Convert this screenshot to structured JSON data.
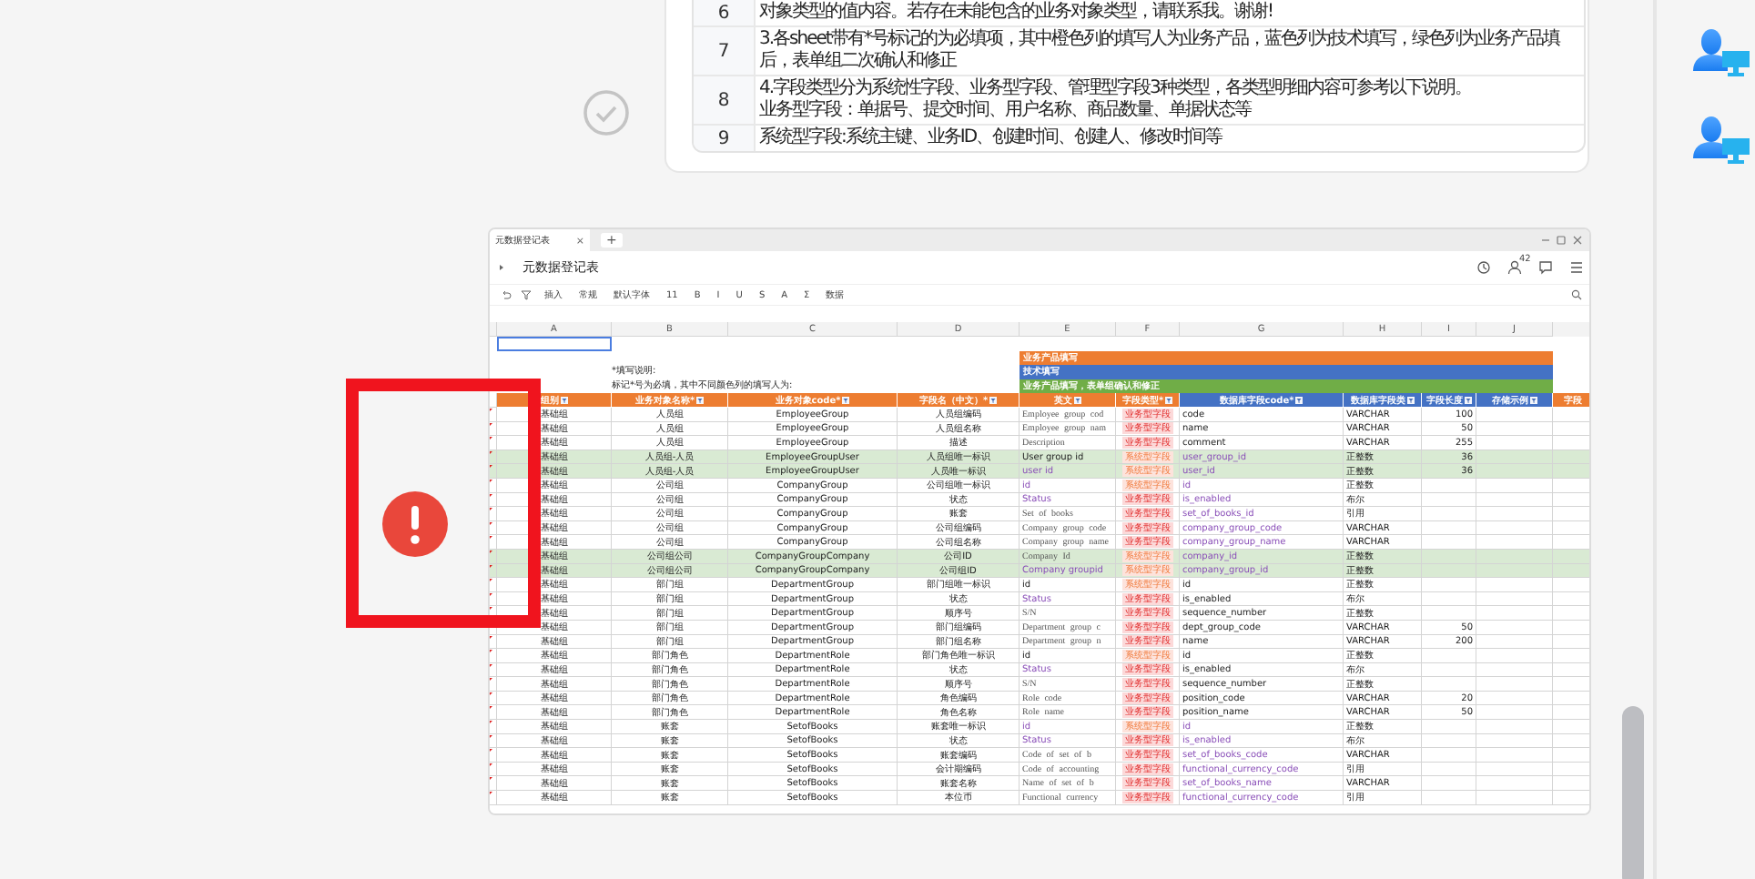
{
  "notes_card": {
    "rows": [
      {
        "number": "6",
        "lines": [
          "对象类型的值内容。若存在未能包含的业务对象类型，请联系我。谢谢!"
        ]
      },
      {
        "number": "7",
        "lines": [
          "3.各sheet带有*号标记的为必填项，其中橙色列的填写人为业务产品，蓝色列为技术填写，绿色列为业务产品填",
          "后，表单组二次确认和修正"
        ]
      },
      {
        "number": "8",
        "lines": [
          "4.字段类型分为系统性字段、业务型字段、管理型字段3种类型，各类型明细内容可参考以下说明。",
          "业务型字段：单据号、提交时间、用户名称、商品数量、单据状态等"
        ]
      },
      {
        "number": "9",
        "lines": [
          "系统型字段:系统主键、业务ID、创建时间、创建人、修改时间等"
        ]
      }
    ]
  },
  "sheet": {
    "tab": "元数据登记表",
    "tab_close": "×",
    "new_tab": "+",
    "title": "元数据登记表",
    "notification_count": "42",
    "toolbar": [
      "插入",
      "常规",
      "默认字体",
      "11",
      "B",
      "I",
      "U",
      "S",
      "A",
      "Σ",
      "数据"
    ],
    "column_letters": [
      "A",
      "B",
      "C",
      "D",
      "E",
      "F",
      "G",
      "H",
      "I",
      "J"
    ],
    "instructions": [
      "*填写说明:",
      "标记*号为必填，其中不同颜色列的填写人为:"
    ],
    "legend": [
      {
        "label": "业务产品填写",
        "color": "#ed7d31"
      },
      {
        "label": "技术填写",
        "color": "#4472c4"
      },
      {
        "label": "业务产品填写，表单组确认和修正",
        "color": "#70ad47"
      }
    ],
    "columns": [
      {
        "label": "组别",
        "color": "#ed7d31"
      },
      {
        "label": "业务对象名称*",
        "color": "#ed7d31"
      },
      {
        "label": "业务对象code*",
        "color": "#ed7d31"
      },
      {
        "label": "字段名（中文）*",
        "color": "#ed7d31"
      },
      {
        "label": "英文",
        "color": "#ed7d31"
      },
      {
        "label": "字段类型*",
        "color": "#ed7d31"
      },
      {
        "label": "数据库字段code*",
        "color": "#4472c4"
      },
      {
        "label": "数据库字段类",
        "color": "#4472c4"
      },
      {
        "label": "字段长度",
        "color": "#4472c4"
      },
      {
        "label": "存储示例",
        "color": "#4472c4"
      },
      {
        "label": "字段",
        "color": "#ed7d31"
      }
    ],
    "rows": [
      {
        "highlighted": false,
        "system_field": false,
        "english_serif": true,
        "english_link": false,
        "code_link": false,
        "cells": [
          "基础组",
          "人员组",
          "EmployeeGroup",
          "人员组编码",
          "Employee group cod",
          "业务型字段",
          "code",
          "VARCHAR",
          "100"
        ]
      },
      {
        "highlighted": false,
        "system_field": false,
        "english_serif": true,
        "english_link": false,
        "code_link": false,
        "cells": [
          "基础组",
          "人员组",
          "EmployeeGroup",
          "人员组名称",
          "Employee group nam",
          "业务型字段",
          "name",
          "VARCHAR",
          "50"
        ]
      },
      {
        "highlighted": false,
        "system_field": false,
        "english_serif": true,
        "english_link": false,
        "code_link": false,
        "cells": [
          "基础组",
          "人员组",
          "EmployeeGroup",
          "描述",
          "Description",
          "业务型字段",
          "comment",
          "VARCHAR",
          "255"
        ]
      },
      {
        "highlighted": true,
        "system_field": true,
        "english_serif": false,
        "english_link": false,
        "code_link": true,
        "cells": [
          "基础组",
          "人员组-人员",
          "EmployeeGroupUser",
          "人员组唯一标识",
          "User group id",
          "系统型字段",
          "user_group_id",
          "正整数",
          "36"
        ]
      },
      {
        "highlighted": true,
        "system_field": true,
        "english_serif": false,
        "english_link": true,
        "code_link": true,
        "cells": [
          "基础组",
          "人员组-人员",
          "EmployeeGroupUser",
          "人员唯一标识",
          "user id",
          "系统型字段",
          "user_id",
          "正整数",
          "36"
        ]
      },
      {
        "highlighted": false,
        "system_field": true,
        "english_serif": false,
        "english_link": true,
        "code_link": true,
        "cells": [
          "基础组",
          "公司组",
          "CompanyGroup",
          "公司组唯一标识",
          "id",
          "系统型字段",
          "id",
          "正整数"
        ]
      },
      {
        "highlighted": false,
        "system_field": false,
        "english_serif": false,
        "english_link": true,
        "code_link": true,
        "cells": [
          "基础组",
          "公司组",
          "CompanyGroup",
          "状态",
          "Status",
          "业务型字段",
          "is_enabled",
          "布尔"
        ]
      },
      {
        "highlighted": false,
        "system_field": false,
        "english_serif": true,
        "english_link": false,
        "code_link": true,
        "cells": [
          "基础组",
          "公司组",
          "CompanyGroup",
          "账套",
          "Set of books",
          "业务型字段",
          "set_of_books_id",
          "引用"
        ]
      },
      {
        "highlighted": false,
        "system_field": false,
        "english_serif": true,
        "english_link": false,
        "code_link": true,
        "cells": [
          "基础组",
          "公司组",
          "CompanyGroup",
          "公司组编码",
          "Company group code",
          "业务型字段",
          "company_group_code",
          "VARCHAR"
        ]
      },
      {
        "highlighted": false,
        "system_field": false,
        "english_serif": true,
        "english_link": false,
        "code_link": true,
        "cells": [
          "基础组",
          "公司组",
          "CompanyGroup",
          "公司组名称",
          "Company group name",
          "业务型字段",
          "company_group_name",
          "VARCHAR"
        ]
      },
      {
        "highlighted": true,
        "system_field": true,
        "english_serif": true,
        "english_link": false,
        "code_link": true,
        "cells": [
          "基础组",
          "公司组公司",
          "CompanyGroupCompany",
          "公司ID",
          "Company Id",
          "系统型字段",
          "company_id",
          "正整数"
        ]
      },
      {
        "highlighted": true,
        "system_field": true,
        "english_serif": false,
        "english_link": true,
        "code_link": true,
        "cells": [
          "基础组",
          "公司组公司",
          "CompanyGroupCompany",
          "公司组ID",
          "Company groupid",
          "系统型字段",
          "company_group_id",
          "正整数"
        ]
      },
      {
        "highlighted": false,
        "system_field": true,
        "english_serif": false,
        "english_link": false,
        "code_link": false,
        "cells": [
          "基础组",
          "部门组",
          "DepartmentGroup",
          "部门组唯一标识",
          "id",
          "系统型字段",
          "id",
          "正整数"
        ]
      },
      {
        "highlighted": false,
        "system_field": false,
        "english_serif": false,
        "english_link": true,
        "code_link": false,
        "cells": [
          "基础组",
          "部门组",
          "DepartmentGroup",
          "状态",
          "Status",
          "业务型字段",
          "is_enabled",
          "布尔"
        ]
      },
      {
        "highlighted": false,
        "system_field": false,
        "english_serif": true,
        "english_link": false,
        "code_link": false,
        "cells": [
          "基础组",
          "部门组",
          "DepartmentGroup",
          "顺序号",
          "S/N",
          "业务型字段",
          "sequence_number",
          "正整数"
        ]
      },
      {
        "highlighted": false,
        "system_field": false,
        "english_serif": true,
        "english_link": false,
        "code_link": false,
        "cells": [
          "基础组",
          "部门组",
          "DepartmentGroup",
          "部门组编码",
          "Department group c",
          "业务型字段",
          "dept_group_code",
          "VARCHAR",
          "50"
        ]
      },
      {
        "highlighted": false,
        "system_field": false,
        "english_serif": true,
        "english_link": false,
        "code_link": false,
        "cells": [
          "基础组",
          "部门组",
          "DepartmentGroup",
          "部门组名称",
          "Department group n",
          "业务型字段",
          "name",
          "VARCHAR",
          "200"
        ]
      },
      {
        "highlighted": false,
        "system_field": true,
        "english_serif": false,
        "english_link": false,
        "code_link": false,
        "cells": [
          "基础组",
          "部门角色",
          "DepartmentRole",
          "部门角色唯一标识",
          "id",
          "系统型字段",
          "id",
          "正整数"
        ]
      },
      {
        "highlighted": false,
        "system_field": false,
        "english_serif": false,
        "english_link": true,
        "code_link": false,
        "cells": [
          "基础组",
          "部门角色",
          "DepartmentRole",
          "状态",
          "Status",
          "业务型字段",
          "is_enabled",
          "布尔"
        ]
      },
      {
        "highlighted": false,
        "system_field": false,
        "english_serif": true,
        "english_link": false,
        "code_link": false,
        "cells": [
          "基础组",
          "部门角色",
          "DepartmentRole",
          "顺序号",
          "S/N",
          "业务型字段",
          "sequence_number",
          "正整数"
        ]
      },
      {
        "highlighted": false,
        "system_field": false,
        "english_serif": true,
        "english_link": false,
        "code_link": false,
        "cells": [
          "基础组",
          "部门角色",
          "DepartmentRole",
          "角色编码",
          "Role code",
          "业务型字段",
          "position_code",
          "VARCHAR",
          "20"
        ]
      },
      {
        "highlighted": false,
        "system_field": false,
        "english_serif": true,
        "english_link": false,
        "code_link": false,
        "cells": [
          "基础组",
          "部门角色",
          "DepartmentRole",
          "角色名称",
          "Role name",
          "业务型字段",
          "position_name",
          "VARCHAR",
          "50"
        ]
      },
      {
        "highlighted": false,
        "system_field": true,
        "english_serif": false,
        "english_link": true,
        "code_link": true,
        "cells": [
          "基础组",
          "账套",
          "SetofBooks",
          "账套唯一标识",
          "id",
          "系统型字段",
          "id",
          "正整数"
        ]
      },
      {
        "highlighted": false,
        "system_field": false,
        "english_serif": false,
        "english_link": true,
        "code_link": true,
        "cells": [
          "基础组",
          "账套",
          "SetofBooks",
          "状态",
          "Status",
          "业务型字段",
          "is_enabled",
          "布尔"
        ]
      },
      {
        "highlighted": false,
        "system_field": false,
        "english_serif": true,
        "english_link": false,
        "code_link": true,
        "cells": [
          "基础组",
          "账套",
          "SetofBooks",
          "账套编码",
          "Code of set of b",
          "业务型字段",
          "set_of_books_code",
          "VARCHAR"
        ]
      },
      {
        "highlighted": false,
        "system_field": false,
        "english_serif": true,
        "english_link": false,
        "code_link": true,
        "cells": [
          "基础组",
          "账套",
          "SetofBooks",
          "会计期编码",
          "Code of accounting",
          "业务型字段",
          "functional_currency_code",
          "引用"
        ]
      },
      {
        "highlighted": false,
        "system_field": false,
        "english_serif": true,
        "english_link": false,
        "code_link": true,
        "cells": [
          "基础组",
          "账套",
          "SetofBooks",
          "账套名称",
          "Name of set of b",
          "业务型字段",
          "set_of_books_name",
          "VARCHAR"
        ]
      },
      {
        "highlighted": false,
        "system_field": false,
        "english_serif": true,
        "english_link": false,
        "code_link": true,
        "cells": [
          "基础组",
          "账套",
          "SetofBooks",
          "本位币",
          "Functional currency",
          "业务型字段",
          "functional_currency_code",
          "引用"
        ]
      }
    ]
  }
}
